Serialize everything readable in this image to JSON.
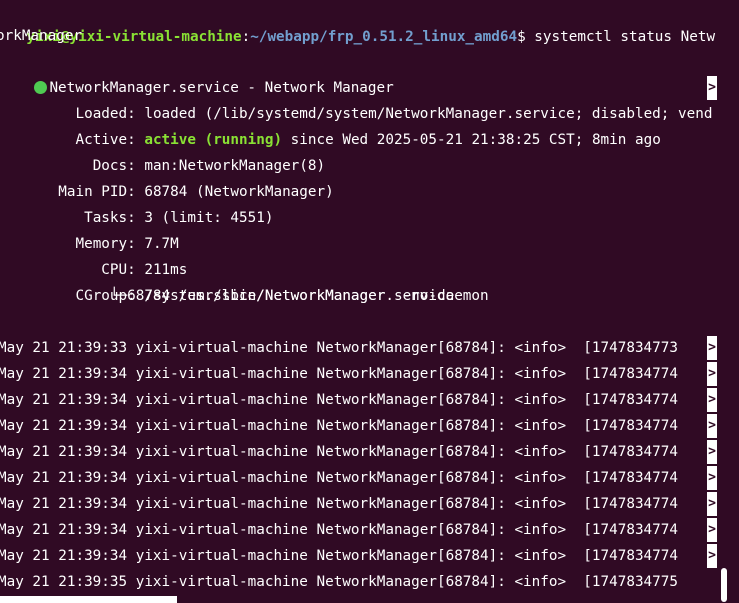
{
  "terminal": {
    "prompt_user": "yixi@yixi-virtual-machine",
    "prompt_sep": ":",
    "prompt_path": "~/webapp/frp_0.51.2_linux_amd64",
    "prompt_end": "$ ",
    "command": "systemctl status Netw",
    "command_wrap": "orkManager",
    "unit_title": "NetworkManager.service - Network Manager",
    "loaded_label": "     Loaded: ",
    "loaded_value": "loaded (/lib/systemd/system/NetworkManager.service; disabled; vend",
    "active_label": "     Active: ",
    "active_state": "active (running)",
    "active_since": " since Wed 2025-05-21 21:38:25 CST; 8min ago",
    "docs_label": "       Docs: ",
    "docs_value": "man:NetworkManager(8)",
    "mainpid_label": "   Main PID: ",
    "mainpid_value": "68784 (NetworkManager)",
    "tasks_label": "      Tasks: ",
    "tasks_value": "3 (limit: 4551)",
    "memory_label": "     Memory: ",
    "memory_value": "7.7M",
    "cpu_label": "        CPU: ",
    "cpu_value": "211ms",
    "cgroup_label": "     CGroup: ",
    "cgroup_value": "/system.slice/NetworkManager.service",
    "cgroup_child": "             └─68784 /usr/sbin/NetworkManager --no-daemon",
    "truncation_marker": ">",
    "log_lines": [
      "May 21 21:39:33 yixi-virtual-machine NetworkManager[68784]: <info>  [1747834773",
      "May 21 21:39:34 yixi-virtual-machine NetworkManager[68784]: <info>  [1747834774",
      "May 21 21:39:34 yixi-virtual-machine NetworkManager[68784]: <info>  [1747834774",
      "May 21 21:39:34 yixi-virtual-machine NetworkManager[68784]: <info>  [1747834774",
      "May 21 21:39:34 yixi-virtual-machine NetworkManager[68784]: <info>  [1747834774",
      "May 21 21:39:34 yixi-virtual-machine NetworkManager[68784]: <info>  [1747834774",
      "May 21 21:39:34 yixi-virtual-machine NetworkManager[68784]: <info>  [1747834774",
      "May 21 21:39:34 yixi-virtual-machine NetworkManager[68784]: <info>  [1747834774",
      "May 21 21:39:34 yixi-virtual-machine NetworkManager[68784]: <info>  [1747834774",
      "May 21 21:39:35 yixi-virtual-machine NetworkManager[68784]: <info>  [1747834775"
    ]
  },
  "colors": {
    "background": "#300a24",
    "prompt_user": "#8ae234",
    "prompt_path": "#729fcf",
    "active": "#8ae234",
    "status_dot": "#4fca52"
  }
}
